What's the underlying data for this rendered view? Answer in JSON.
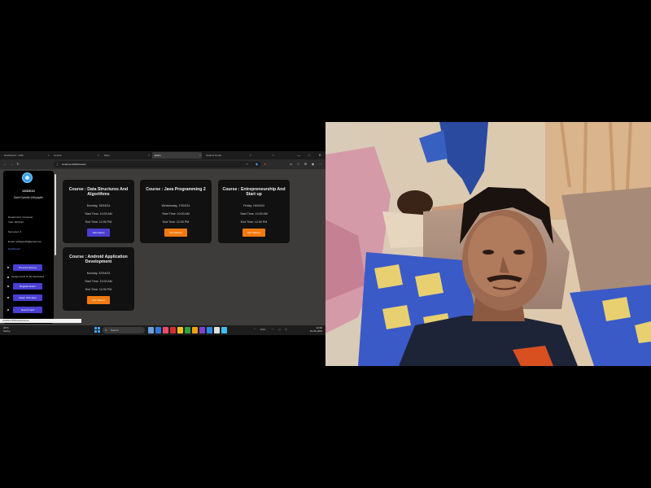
{
  "browser": {
    "tabs": [
      {
        "label": "Dashboard - LMS",
        "active": false
      },
      {
        "label": "Course",
        "active": false
      },
      {
        "label": "Meet",
        "active": false
      },
      {
        "label": "Exam",
        "active": true
      },
      {
        "label": "Student Portal",
        "active": false
      },
      {
        "label": "",
        "active": false
      }
    ],
    "url": "localhost:3000/student",
    "window_controls": [
      "—",
      "□",
      "✕"
    ]
  },
  "sidebar": {
    "name": "23IDE24",
    "subtitle": "Sahil Gandhi Vidhyapith",
    "info": [
      "Department: Computer",
      "Year: 2023-24",
      "Semester: 4",
      "Email: sahilgandhi@gmail.com"
    ],
    "section_label": "Dashboard",
    "buttons": [
      "Previous Exams",
      "Register Exam",
      "Exam Schedule",
      "Result Card"
    ],
    "menu_text": "Assignments To Be Submitted"
  },
  "cards": [
    {
      "title": "Course : Data Structures And Algorithms",
      "date": "Monday, 15/04/24",
      "start": "Start Time: 10:00 AM",
      "end": "End Time: 12:00 PM",
      "button": "Start Exam",
      "button_color": "blue"
    },
    {
      "title": "Course : Java Programming 2",
      "date": "Wednesday, 17/04/24",
      "start": "Start Time: 10:00 AM",
      "end": "End Time: 12:00 PM",
      "button": "Not Started",
      "button_color": "orange"
    },
    {
      "title": "Course : Entrepreneurship And Start up",
      "date": "Friday, 19/04/24",
      "start": "Start Time: 10:00 AM",
      "end": "End Time: 12:00 PM",
      "button": "Not Started",
      "button_color": "orange"
    },
    {
      "title": "Course : Android Application Development",
      "date": "Monday, 22/04/24",
      "start": "Start Time: 10:00 AM",
      "end": "End Time: 12:00 PM",
      "button": "Not Started",
      "button_color": "orange"
    }
  ],
  "statusbar": "localhost:3000/student/exam",
  "taskbar": {
    "weather_temp": "32°C",
    "weather_desc": "Sunny",
    "search_placeholder": "Search",
    "time": "12:30",
    "date": "15-04-2024",
    "tray": "ENG"
  },
  "colors": {
    "accent_blue": "#4a3fd0",
    "accent_orange": "#f07a10",
    "card_bg": "#111111",
    "page_bg": "#3e3c3a"
  }
}
